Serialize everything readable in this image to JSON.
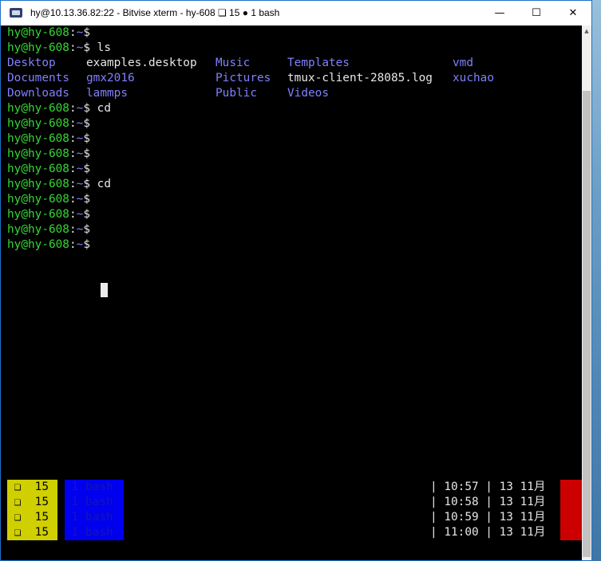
{
  "window": {
    "title": "hy@10.13.36.82:22 - Bitvise xterm - hy-608 ❏ 15 ● 1 bash",
    "buttons": {
      "minimize": "—",
      "maximize": "☐",
      "close": "✕"
    }
  },
  "prompt": {
    "user_host": "hy@hy-608",
    "sep": ":",
    "path": "~",
    "sigil": "$"
  },
  "terminal": {
    "lines": [
      {
        "type": "prompt",
        "cmd": ""
      },
      {
        "type": "prompt",
        "cmd": " ls"
      },
      {
        "type": "ls",
        "cols": [
          {
            "text": "Desktop",
            "color": "blu"
          },
          {
            "text": "examples.desktop",
            "color": "wht"
          },
          {
            "text": "Music",
            "color": "blu"
          },
          {
            "text": "Templates",
            "color": "blu"
          },
          {
            "text": "vmd",
            "color": "blu"
          }
        ]
      },
      {
        "type": "ls",
        "cols": [
          {
            "text": "Documents",
            "color": "blu"
          },
          {
            "text": "gmx2016",
            "color": "blu"
          },
          {
            "text": "Pictures",
            "color": "blu"
          },
          {
            "text": "tmux-client-28085.log",
            "color": "wht"
          },
          {
            "text": "xuchao",
            "color": "blu"
          }
        ]
      },
      {
        "type": "ls",
        "cols": [
          {
            "text": "Downloads",
            "color": "blu"
          },
          {
            "text": "lammps",
            "color": "blu"
          },
          {
            "text": "Public",
            "color": "blu"
          },
          {
            "text": "Videos",
            "color": "blu"
          },
          {
            "text": "",
            "color": "blu"
          }
        ]
      },
      {
        "type": "prompt",
        "cmd": " cd"
      },
      {
        "type": "prompt",
        "cmd": ""
      },
      {
        "type": "prompt",
        "cmd": ""
      },
      {
        "type": "prompt",
        "cmd": ""
      },
      {
        "type": "prompt",
        "cmd": ""
      },
      {
        "type": "prompt",
        "cmd": " cd"
      },
      {
        "type": "prompt",
        "cmd": ""
      },
      {
        "type": "prompt",
        "cmd": ""
      },
      {
        "type": "prompt",
        "cmd": ""
      },
      {
        "type": "prompt",
        "cmd": ""
      }
    ]
  },
  "status_bar": {
    "rows": [
      {
        "ws": " ❏  15",
        "win": " 1 bash",
        "clock": "| 10:57 | 13 11月"
      },
      {
        "ws": " ❏  15",
        "win": " 1 bash",
        "clock": "| 10:58 | 13 11月"
      },
      {
        "ws": " ❏  15",
        "win": " 1 bash",
        "clock": "| 10:59 | 13 11月"
      },
      {
        "ws": " ❏  15",
        "win": " 1 bash",
        "clock": "| 11:00 | 13 11月"
      }
    ]
  },
  "colors": {
    "prompt_green": "#35d635",
    "dir_blue": "#8080ff",
    "badge_yellow": "#d0cf00",
    "badge_blue": "#0000ee",
    "alert_red": "#cc0000"
  }
}
